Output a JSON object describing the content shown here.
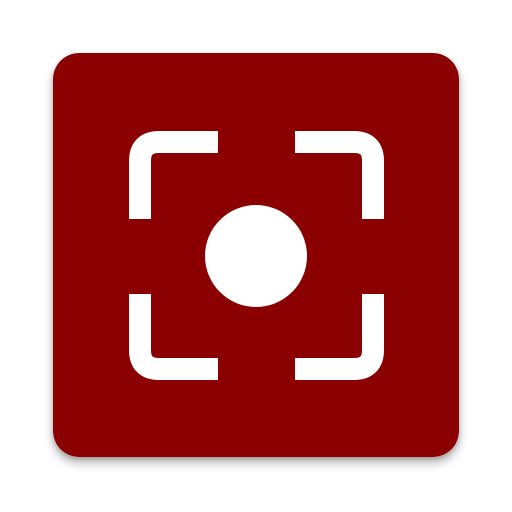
{
  "app_icon": {
    "name": "screenshot-capture-app-icon",
    "icon": "focus-frame-record-icon",
    "colors": {
      "background": "#8B0000",
      "foreground": "#FFFFFF"
    }
  }
}
